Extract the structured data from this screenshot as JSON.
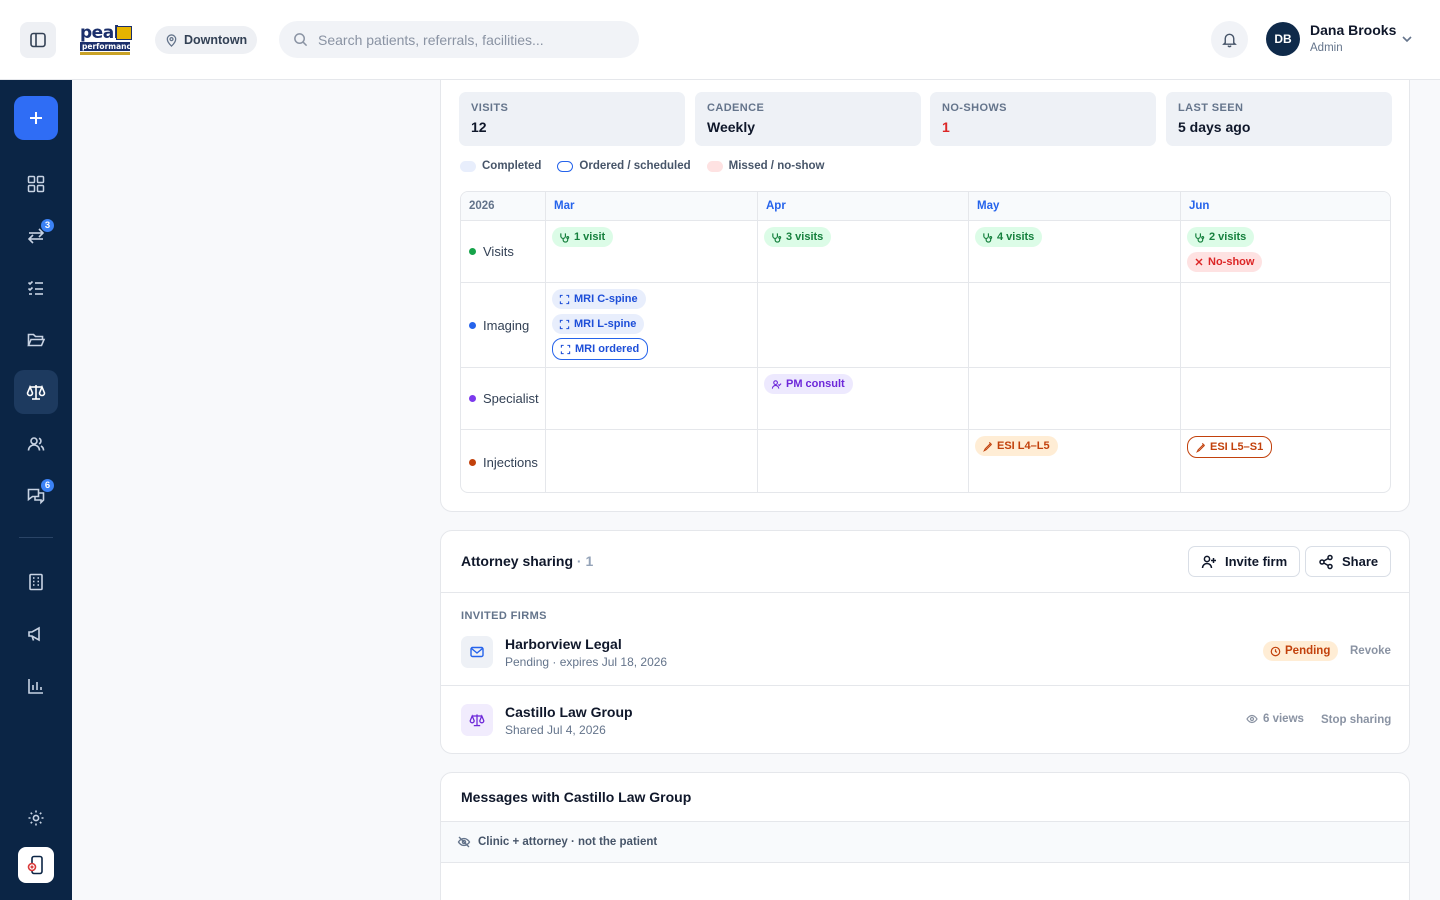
{
  "header": {
    "location": "Downtown",
    "search_placeholder": "Search patients, referrals, facilities...",
    "user": {
      "initials": "DB",
      "name": "Dana Brooks",
      "role": "Admin"
    },
    "logo": {
      "line1": "peak",
      "line2": "performance"
    }
  },
  "sidebar": {
    "referrals_badge": "3",
    "messages_badge": "6"
  },
  "stats": [
    {
      "label": "VISITS",
      "value": "12"
    },
    {
      "label": "CADENCE",
      "value": "Weekly"
    },
    {
      "label": "NO-SHOWS",
      "value": "1"
    },
    {
      "label": "LAST SEEN",
      "value": "5 days ago"
    }
  ],
  "legend": [
    "Completed",
    "Ordered / scheduled",
    "Missed / no-show"
  ],
  "timeline": {
    "year": "2026",
    "months": [
      "Mar",
      "Apr",
      "May",
      "Jun"
    ],
    "rows": [
      "Visits",
      "Imaging",
      "Specialist",
      "Injections"
    ],
    "chips": {
      "visits_mar": "1 visit",
      "visits_apr": "3 visits",
      "visits_may": "4 visits",
      "visits_jun": "2 visits",
      "noshow_jun": "No-show",
      "mri_c": "MRI C-spine",
      "mri_l": "MRI L-spine",
      "mri_ordered": "MRI ordered",
      "pm_consult": "PM consult",
      "esi_l4": "ESI L4–L5",
      "esi_l5": "ESI L5–S1"
    }
  },
  "sharing": {
    "title": "Attorney sharing",
    "count": "· 1",
    "invite_label": "Invite firm",
    "share_label": "Share",
    "subheading": "INVITED FIRMS",
    "firms": [
      {
        "name": "Harborview Legal",
        "meta": "Pending · expires Jul 18, 2026",
        "status": "Pending",
        "action": "Revoke"
      },
      {
        "name": "Castillo Law Group",
        "meta": "Shared Jul 4, 2026",
        "views": "6 views",
        "action": "Stop sharing"
      }
    ]
  },
  "messages": {
    "title": "Messages with Castillo Law Group",
    "note": "Clinic + attorney · not the patient"
  },
  "colors": {
    "sidebar": "#0b2545",
    "accent": "#2f6df5",
    "visits": "#16a34a",
    "imaging": "#2563eb",
    "specialist": "#7c3aed",
    "injections": "#c2410c"
  }
}
